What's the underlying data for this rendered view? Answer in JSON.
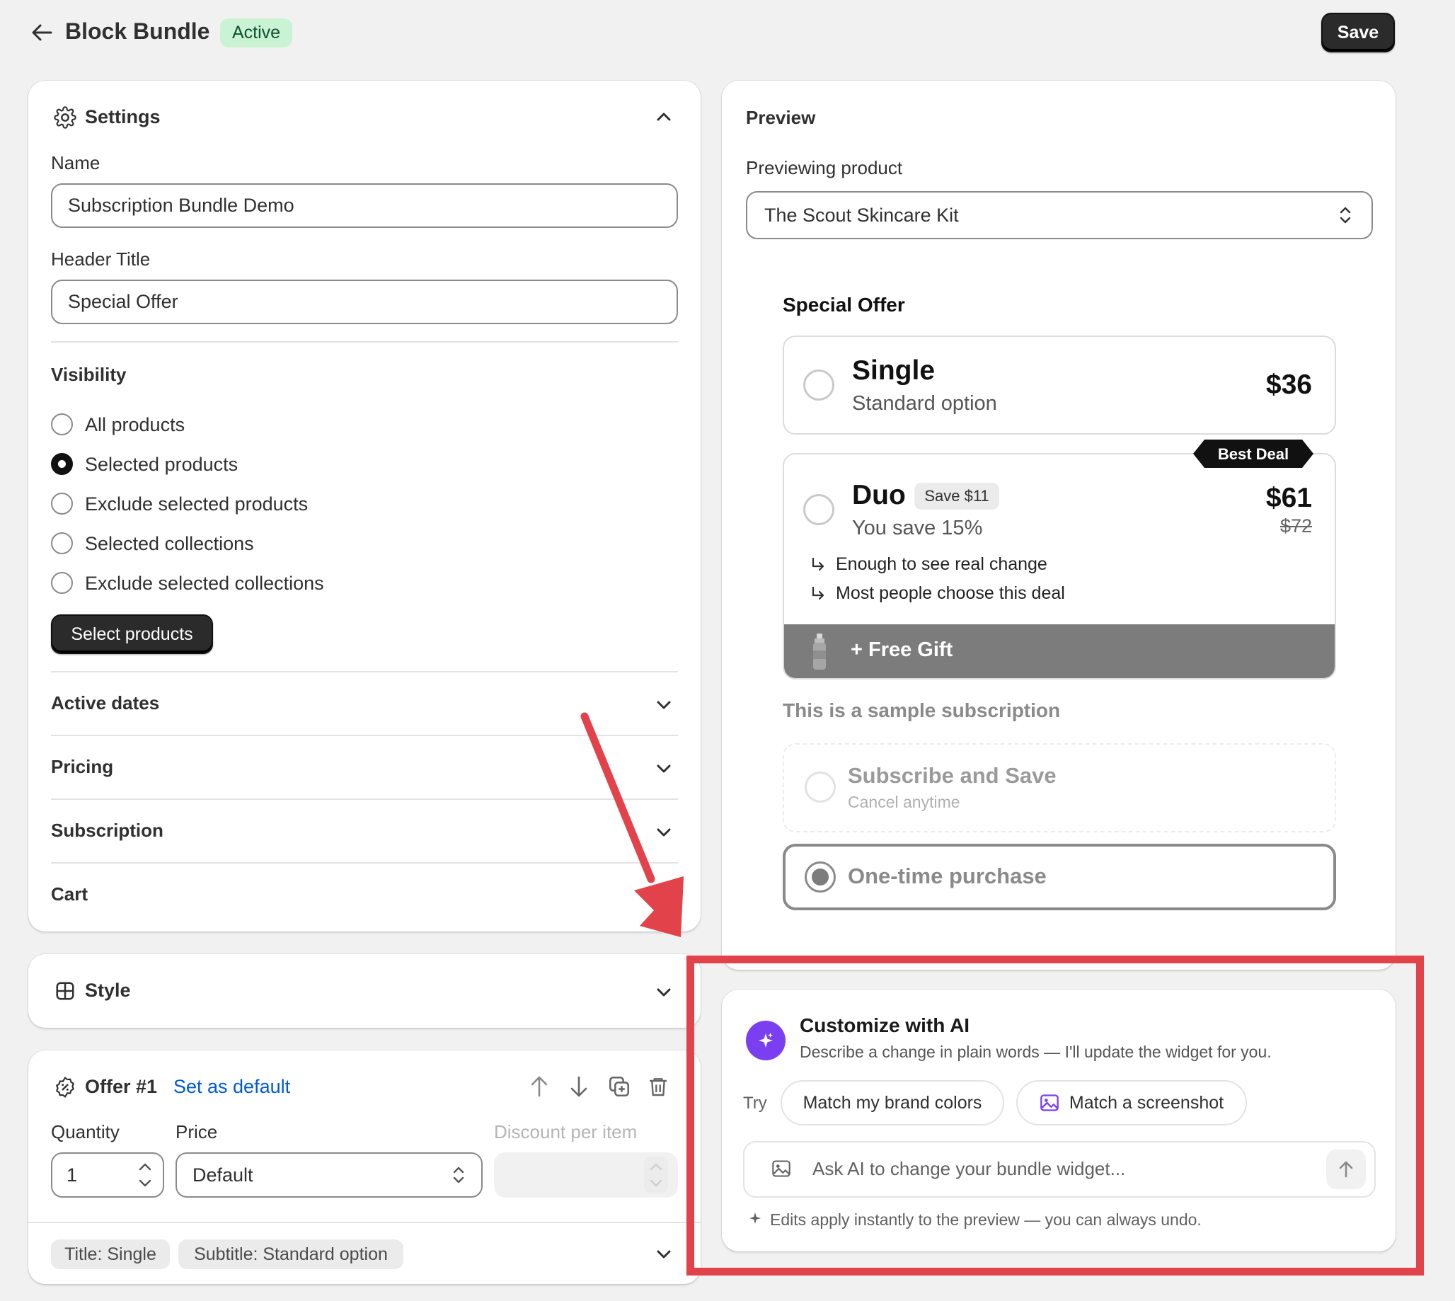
{
  "header": {
    "title": "Block Bundle",
    "status": "Active",
    "save_label": "Save"
  },
  "settings": {
    "title": "Settings",
    "name_label": "Name",
    "name_value": "Subscription Bundle Demo",
    "header_title_label": "Header Title",
    "header_title_value": "Special Offer",
    "visibility_label": "Visibility",
    "visibility_options": [
      {
        "label": "All products",
        "selected": false
      },
      {
        "label": "Selected products",
        "selected": true
      },
      {
        "label": "Exclude selected products",
        "selected": false
      },
      {
        "label": "Selected collections",
        "selected": false
      },
      {
        "label": "Exclude selected collections",
        "selected": false
      }
    ],
    "select_products_label": "Select products",
    "sections": [
      "Active dates",
      "Pricing",
      "Subscription",
      "Cart"
    ]
  },
  "style": {
    "title": "Style"
  },
  "offer": {
    "title": "Offer #1",
    "set_default_label": "Set as default",
    "quantity_label": "Quantity",
    "quantity_value": "1",
    "price_label": "Price",
    "price_value": "Default",
    "discount_label": "Discount per item",
    "tags": [
      "Title: Single",
      "Subtitle: Standard option"
    ]
  },
  "preview": {
    "title": "Preview",
    "previewing_label": "Previewing product",
    "product_value": "The Scout Skincare Kit",
    "offer_heading": "Special Offer",
    "single": {
      "title": "Single",
      "subtitle": "Standard option",
      "price": "$36"
    },
    "duo": {
      "badge": "Best Deal",
      "title": "Duo",
      "save_chip": "Save $11",
      "subtitle": "You save 15%",
      "price": "$61",
      "compare_price": "$72",
      "bullets": [
        "Enough to see real change",
        "Most people choose this deal"
      ],
      "gift_label": "+ Free Gift"
    },
    "subscription_heading": "This is a sample subscription",
    "subscribe_title": "Subscribe and Save",
    "subscribe_subtitle": "Cancel anytime",
    "one_time_label": "One-time purchase"
  },
  "ai": {
    "title": "Customize with AI",
    "description": "Describe a change in plain words — I'll update the widget for you.",
    "try_label": "Try",
    "suggestions": [
      "Match my brand colors",
      "Match a screenshot"
    ],
    "input_placeholder": "Ask AI to change your bundle widget...",
    "footer_note": "Edits apply instantly to the preview — you can always undo."
  },
  "colors": {
    "annotation_red": "#e2434a",
    "ai_purple": "#7b3ff2",
    "link_blue": "#005bd3",
    "active_badge_bg": "#c9f3d3"
  }
}
